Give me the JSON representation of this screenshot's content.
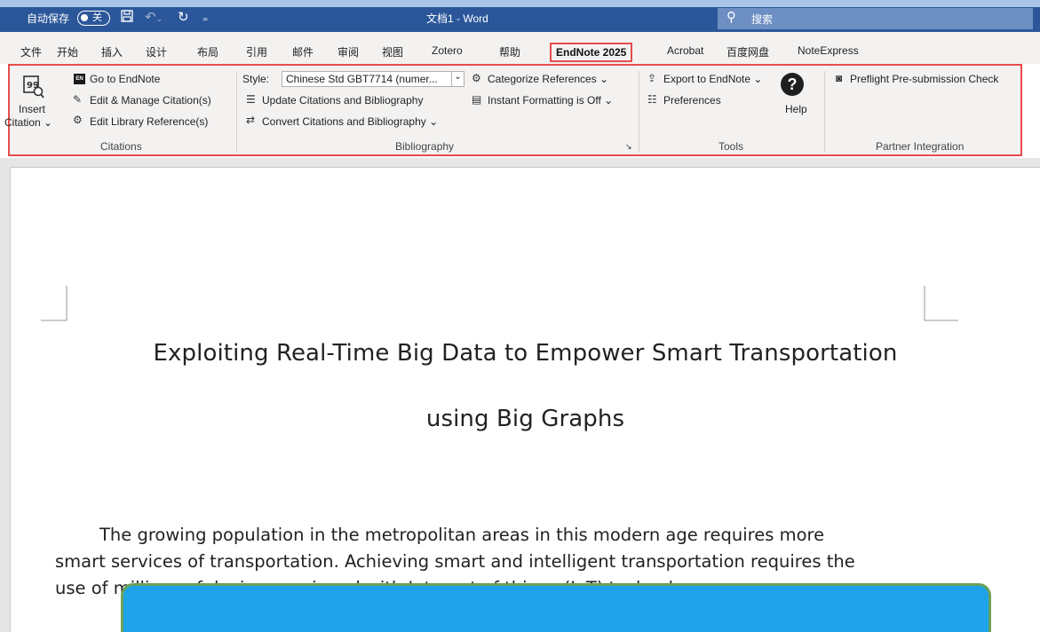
{
  "titlebar": {
    "autosave_label": "自动保存",
    "autosave_state": "关",
    "doc_title": "文档1  -  Word",
    "search_placeholder": "搜索"
  },
  "menu": {
    "tabs": [
      "文件",
      "开始",
      "插入",
      "设计",
      "布局",
      "引用",
      "邮件",
      "审阅",
      "视图",
      "Zotero",
      "帮助",
      "EndNote 2025",
      "Acrobat",
      "百度网盘",
      "NoteExpress"
    ],
    "active": "EndNote 2025"
  },
  "ribbon": {
    "citations": {
      "insert_line1": "Insert",
      "insert_line2": "Citation ⌄",
      "go_to_endnote": "Go to EndNote",
      "edit_manage": "Edit & Manage Citation(s)",
      "edit_library": "Edit Library Reference(s)",
      "group_label": "Citations"
    },
    "bibliography": {
      "style_label": "Style:",
      "style_value": "Chinese Std GBT7714 (numer...",
      "update": "Update Citations and Bibliography",
      "convert": "Convert Citations and Bibliography ⌄",
      "categorize": "Categorize References ⌄",
      "instant_formatting": "Instant Formatting is Off ⌄",
      "group_label": "Bibliography"
    },
    "tools": {
      "export": "Export to EndNote ⌄",
      "preferences": "Preferences",
      "help": "Help",
      "group_label": "Tools"
    },
    "partner": {
      "preflight": "Preflight Pre-submission Check",
      "group_label": "Partner Integration"
    }
  },
  "document": {
    "title_line1": "Exploiting Real-Time Big Data to Empower Smart Transportation",
    "title_line2": "using Big Graphs",
    "para_line1": "The growing population in the metropolitan areas in this modern age requires more",
    "para_line2": "smart services of transportation. Achieving smart and intelligent transportation requires the",
    "para_line3": "use of millions of devices equipped with Internet of things (IoT) technology."
  },
  "colors": {
    "titlebar": "#2b579a",
    "highlight_border": "#e74c4c",
    "callout_fill": "#1ea3e8",
    "callout_border": "#6aa15a"
  }
}
